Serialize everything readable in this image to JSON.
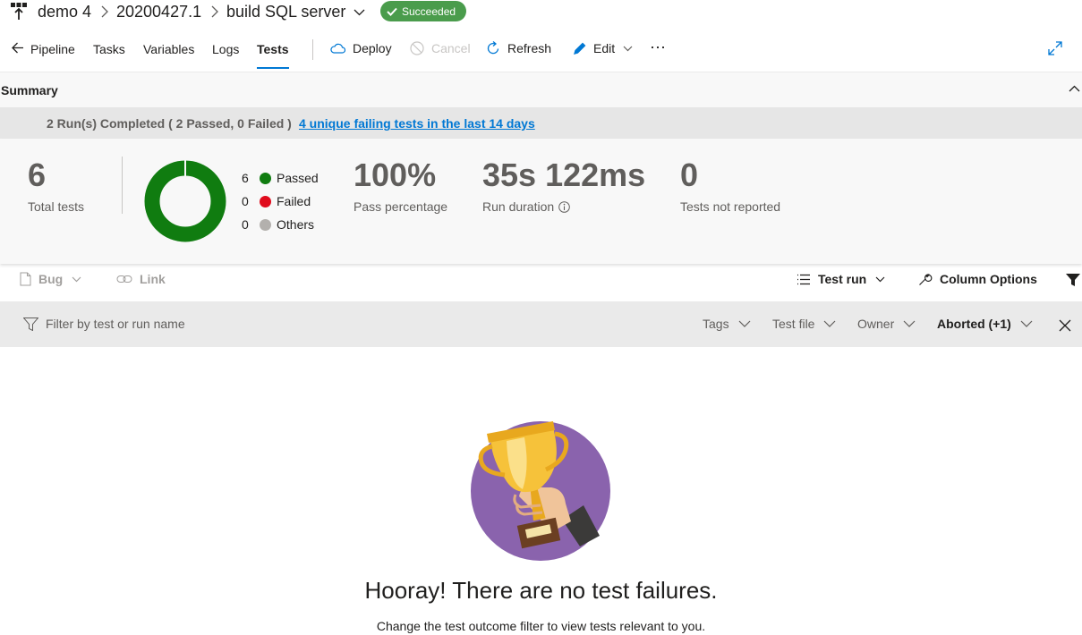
{
  "breadcrumb": {
    "project": "demo 4",
    "build": "20200427.1",
    "pipeline": "build SQL server",
    "status": "Succeeded"
  },
  "tabs": [
    "Pipeline",
    "Tasks",
    "Variables",
    "Logs",
    "Tests"
  ],
  "active_tab": "Tests",
  "commands": {
    "deploy": "Deploy",
    "cancel": "Cancel",
    "refresh": "Refresh",
    "edit": "Edit",
    "more": "⋯"
  },
  "summary": {
    "title": "Summary",
    "runs_text": "2 Run(s) Completed ( 2 Passed, 0 Failed )",
    "failing_link": "4 unique failing tests in the last 14 days",
    "total_tests": "6",
    "total_tests_label": "Total tests",
    "legend": [
      {
        "count": "6",
        "label": "Passed",
        "color": "#107c10"
      },
      {
        "count": "0",
        "label": "Failed",
        "color": "#e00b1c"
      },
      {
        "count": "0",
        "label": "Others",
        "color": "#b3b0ad"
      }
    ],
    "pass_percentage": "100%",
    "pass_percentage_label": "Pass percentage",
    "run_duration": "35s 122ms",
    "run_duration_label": "Run duration",
    "not_reported": "0",
    "not_reported_label": "Tests not reported"
  },
  "toolbar": {
    "bug": "Bug",
    "link": "Link",
    "test_run": "Test run",
    "column_options": "Column Options"
  },
  "filter": {
    "placeholder": "Filter by test or run name",
    "tags": "Tags",
    "test_file": "Test file",
    "owner": "Owner",
    "outcome": "Aborted (+1)"
  },
  "empty_state": {
    "title": "Hooray! There are no test failures.",
    "message": "Change the test outcome filter to view tests relevant to you."
  },
  "colors": {
    "accent": "#0078d4",
    "success": "#4a9c4c",
    "passed": "#107c10",
    "trophy_bg": "#8a63ad"
  }
}
